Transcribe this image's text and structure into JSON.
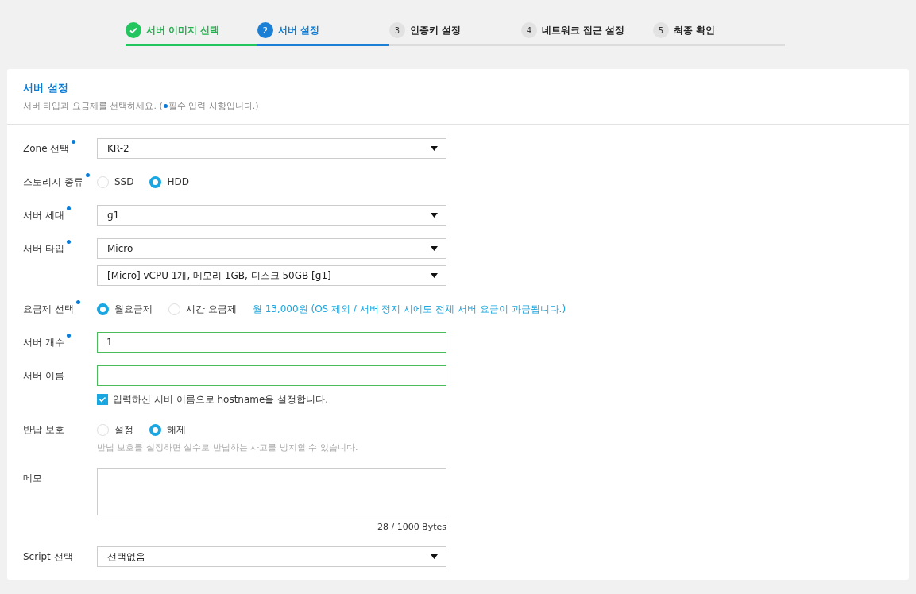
{
  "steps": [
    {
      "label": "서버 이미지 선택",
      "done": true,
      "selected": false
    },
    {
      "number": "2",
      "label": "서버 설정",
      "done": false,
      "selected": true
    },
    {
      "number": "3",
      "label": "인증키 설정",
      "done": false,
      "selected": false
    },
    {
      "number": "4",
      "label": "네트워크 접근 설정",
      "done": false,
      "selected": false
    },
    {
      "number": "5",
      "label": "최종 확인",
      "done": false,
      "selected": false
    }
  ],
  "card": {
    "title": "서버 설정",
    "subtitle_before": "서버 타입과 요금제를 선택하세요. (",
    "subtitle_after": "필수 입력 사항입니다.)"
  },
  "rows": [
    {
      "kind": "select",
      "label": "Zone 선택",
      "required": true,
      "values": [
        "KR-2"
      ]
    },
    {
      "kind": "radio",
      "label": "스토리지 종류",
      "required": true,
      "options": [
        {
          "label": "SSD",
          "selected": false
        },
        {
          "label": "HDD",
          "selected": true
        }
      ]
    },
    {
      "kind": "select",
      "label": "서버 세대",
      "required": true,
      "values": [
        "g1"
      ]
    },
    {
      "kind": "select",
      "label": "서버 타입",
      "required": true,
      "values": [
        "Micro",
        "[Micro] vCPU 1개, 메모리 1GB, 디스크 50GB [g1]"
      ]
    },
    {
      "kind": "radio",
      "label": "요금제 선택",
      "required": true,
      "options": [
        {
          "label": "월요금제",
          "selected": true
        },
        {
          "label": "시간 요금제",
          "selected": false
        }
      ],
      "note": "월 13,000원 (OS 제외 / 서버 정지 시에도 전체 서버 요금이 과금됩니다.)"
    },
    {
      "kind": "input",
      "label": "서버 개수",
      "required": true,
      "value": "1"
    },
    {
      "kind": "input",
      "label": "서버 이름",
      "required": false,
      "value": "",
      "checkbox": {
        "label": "입력하신 서버 이름으로 hostname을 설정합니다.",
        "checked": true
      }
    },
    {
      "kind": "radio",
      "label": "반납 보호",
      "required": false,
      "options": [
        {
          "label": "설정",
          "selected": false
        },
        {
          "label": "해제",
          "selected": true
        }
      ],
      "help": "반납 보호를 설정하면 실수로 반납하는 사고를 방지할 수 있습니다."
    },
    {
      "kind": "textarea",
      "label": "메모",
      "required": false,
      "value": "",
      "counter": "28 / 1000 Bytes"
    },
    {
      "kind": "select",
      "label": "Script 선택",
      "required": false,
      "values": [
        "선택없음"
      ]
    }
  ]
}
